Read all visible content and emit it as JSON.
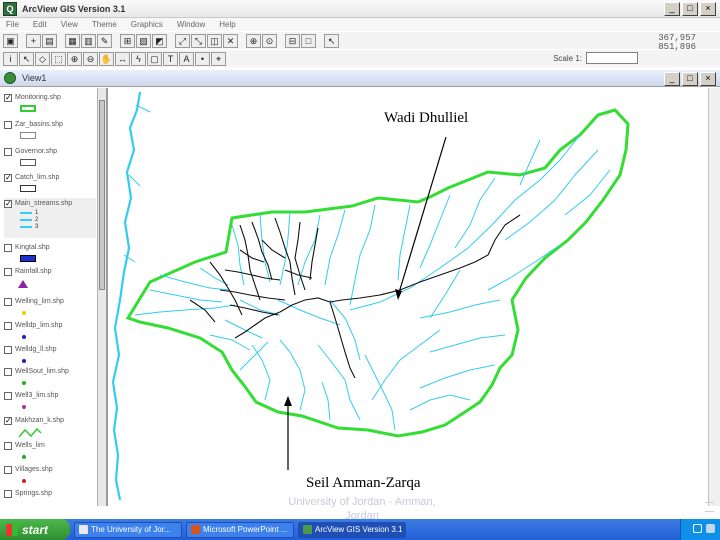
{
  "window": {
    "title": "ArcView GIS Version 3.1",
    "icon": "arcview-globe-icon",
    "controls": [
      "minimize",
      "maximize",
      "close"
    ]
  },
  "menu": [
    "File",
    "Edit",
    "View",
    "Theme",
    "Graphics",
    "Window",
    "Help"
  ],
  "toolbar": {
    "scale_label": "Scale 1:",
    "scale_value": "",
    "coordinates_x": "367,957",
    "coordinates_y": "851,896"
  },
  "view": {
    "title": "View1"
  },
  "legend": {
    "layers": [
      {
        "name": "Monitoring.shp",
        "checked": true,
        "symbol_color": "#33cc33",
        "symbol": "outline-rect"
      },
      {
        "name": "Zar_basins.shp",
        "checked": false,
        "symbol_color": "#ffffff",
        "symbol": "outline-rect"
      },
      {
        "name": "Governor.shp",
        "checked": false,
        "symbol_color": "#ffffff",
        "symbol": "outline-rect"
      },
      {
        "name": "Catch_lim.shp",
        "checked": true,
        "symbol_color": "#ffffff",
        "symbol": "outline-rect"
      },
      {
        "name": "Main_streams.shp",
        "checked": true,
        "symbol_color": "#33ccff",
        "symbol": "lines",
        "classes": [
          "1",
          "2",
          "3"
        ]
      },
      {
        "name": "Kingtal.shp",
        "checked": false,
        "symbol_color": "#1a33cc",
        "symbol": "fill-rect"
      },
      {
        "name": "Rainfall.shp",
        "checked": false,
        "symbol_color": "#8b22a8",
        "symbol": "triangle"
      },
      {
        "name": "Welling_lim.shp",
        "checked": false,
        "symbol_color": "#e6d200",
        "symbol": "dot"
      },
      {
        "name": "Welldp_lim.shp",
        "checked": false,
        "symbol_color": "#2222aa",
        "symbol": "dot"
      },
      {
        "name": "Welldg_ll.shp",
        "checked": false,
        "symbol_color": "#2222aa",
        "symbol": "dot"
      },
      {
        "name": "WellSout_lim.shp",
        "checked": false,
        "symbol_color": "#22aa22",
        "symbol": "dot"
      },
      {
        "name": "Well3_lim.shp",
        "checked": false,
        "symbol_color": "#aa33aa",
        "symbol": "dot"
      },
      {
        "name": "Makhzan_k.shp",
        "checked": true,
        "symbol_color": "#33cc33",
        "symbol": "line"
      },
      {
        "name": "Wells_lim",
        "checked": false,
        "symbol_color": "#22aa22",
        "symbol": "dot"
      },
      {
        "name": "Villages.shp",
        "checked": false,
        "symbol_color": "#cc2222",
        "symbol": "dot"
      },
      {
        "name": "Springs.shp",
        "checked": false,
        "symbol_color": "#22aa22",
        "symbol": "dot"
      }
    ]
  },
  "map": {
    "labels": {
      "wadi": "Wadi Dhulliel",
      "seil": "Seil Amman-Zarqa"
    },
    "colors": {
      "boundary": "#33dd33",
      "streams": "#33ccee",
      "main_channels": "#111111"
    }
  },
  "footer": {
    "line1": "University of Jordan - Amman,",
    "line2": "Jordan"
  },
  "taskbar": {
    "start": "start",
    "tasks": [
      {
        "label": "The University of Jor...",
        "icon_color": "#e8e8e8"
      },
      {
        "label": "Microsoft PowerPoint ...",
        "icon_color": "#d9541a"
      },
      {
        "label": "ArcView GIS Version 3.1",
        "icon_color": "#4a9a4a"
      }
    ]
  }
}
